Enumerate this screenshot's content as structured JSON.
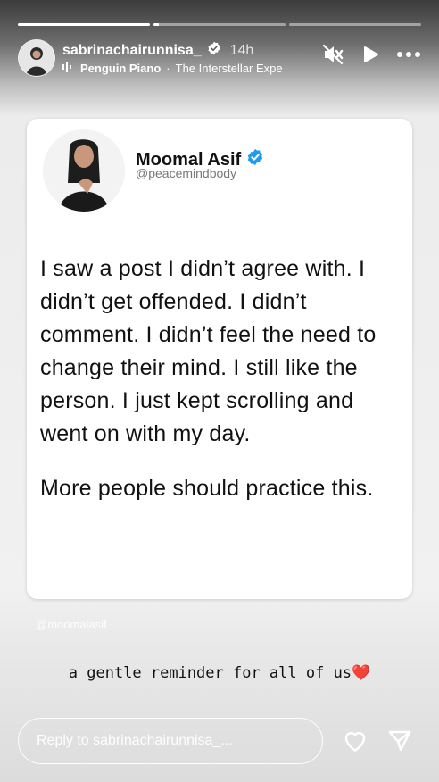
{
  "story": {
    "progress": [
      1.0,
      0.04,
      0.0
    ]
  },
  "header": {
    "username": "sabrinachairunnisa_",
    "time": "14h",
    "music_artist": "Penguin Piano",
    "music_separator": "·",
    "music_title": "The Interstellar Expe"
  },
  "card": {
    "author_name": "Moomal Asif",
    "author_handle": "@peacemindbody",
    "paragraph1": "I saw a post I didn’t agree with. I didn’t get offended. I didn’t comment. I didn’t feel the need to change their mind. I still like the person. I just kept scrolling and went on with my day.",
    "paragraph2": "More people should practice this."
  },
  "watermark": "@moomalasif",
  "caption": {
    "text": "a gentle reminder for all of us",
    "emoji": "❤️"
  },
  "footer": {
    "reply_placeholder": "Reply to sabrinachairunnisa_..."
  },
  "icons": {
    "verified": "verified-badge-icon",
    "mute": "speaker-muted-icon",
    "play": "play-icon",
    "more": "more-dots-icon",
    "like": "heart-icon",
    "send": "send-icon",
    "music": "music-bars-icon"
  },
  "colors": {
    "verified_blue": "#1d9bf0",
    "heart_red": "#d81e3a"
  }
}
